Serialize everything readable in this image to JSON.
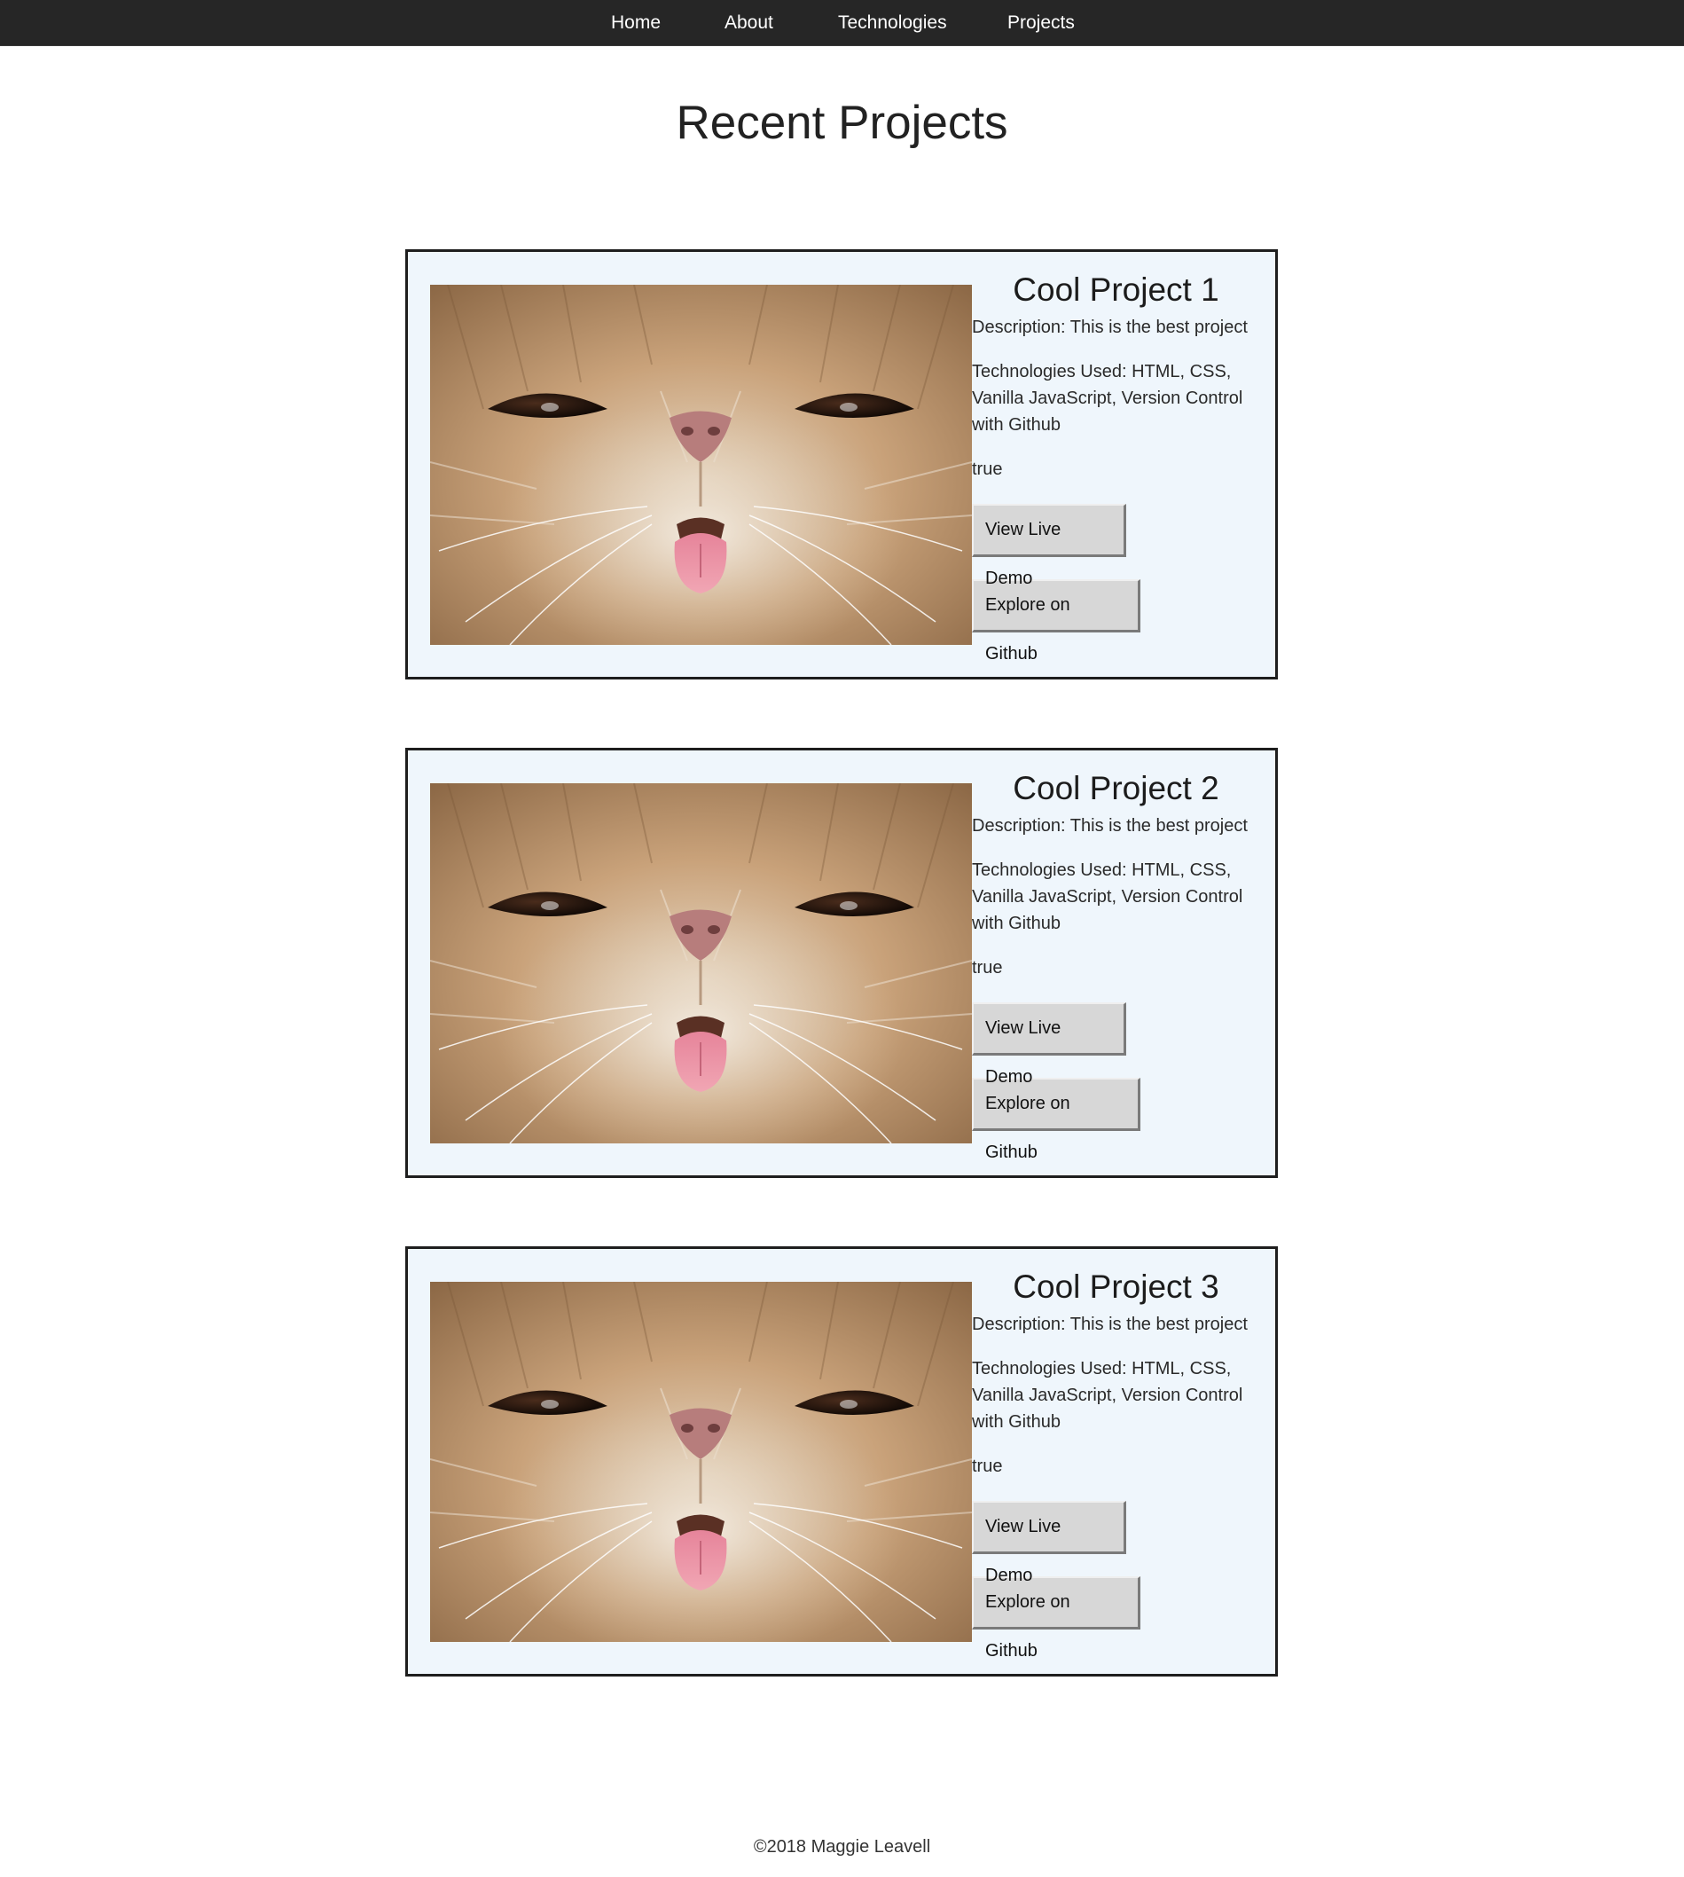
{
  "nav": {
    "items": [
      {
        "label": "Home"
      },
      {
        "label": "About"
      },
      {
        "label": "Technologies"
      },
      {
        "label": "Projects"
      }
    ]
  },
  "main": {
    "title": "Recent Projects",
    "projects": [
      {
        "title": "Cool Project 1",
        "description": "Description: This is the best project",
        "technologies": "Technologies Used: HTML, CSS, Vanilla JavaScript, Version Control with Github",
        "flag": "true",
        "demo_label": "View Live Demo",
        "github_label": "Explore on Github",
        "image_icon": "cat-photo"
      },
      {
        "title": "Cool Project 2",
        "description": "Description: This is the best project",
        "technologies": "Technologies Used: HTML, CSS, Vanilla JavaScript, Version Control with Github",
        "flag": "true",
        "demo_label": "View Live Demo",
        "github_label": "Explore on Github",
        "image_icon": "cat-photo"
      },
      {
        "title": "Cool Project 3",
        "description": "Description: This is the best project",
        "technologies": "Technologies Used: HTML, CSS, Vanilla JavaScript, Version Control with Github",
        "flag": "true",
        "demo_label": "View Live Demo",
        "github_label": "Explore on Github",
        "image_icon": "cat-photo"
      }
    ]
  },
  "footer": {
    "copyright": "©2018 Maggie Leavell"
  },
  "colors": {
    "navbar_bg": "#262626",
    "card_bg": "#eff6fc",
    "card_border": "#1e1e1e",
    "button_bg": "#d7d7d7"
  }
}
